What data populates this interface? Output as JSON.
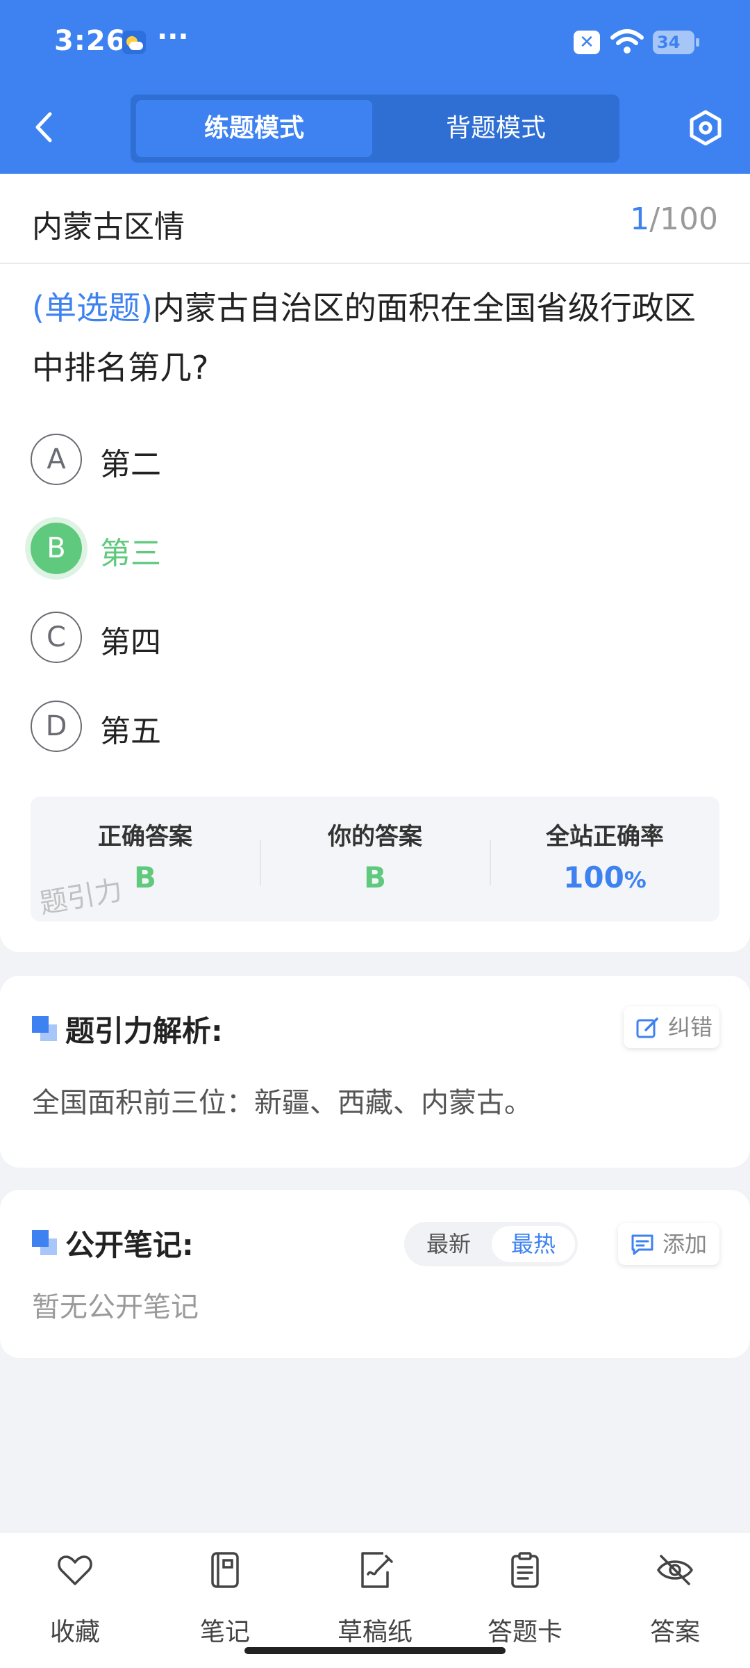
{
  "status_bar": {
    "time": "3:26",
    "more": "···",
    "battery": "34"
  },
  "header": {
    "tabs": [
      {
        "label": "练题模式",
        "active": true
      },
      {
        "label": "背题模式",
        "active": false
      }
    ],
    "icons": {
      "back": "chevron-left-icon",
      "settings": "hexagon-settings-icon"
    },
    "accent_color": "#3d82f0"
  },
  "question_card": {
    "category": "内蒙古区情",
    "progress_current": "1",
    "progress_total": "/100",
    "type_label": "(单选题)",
    "question_text": "内蒙古自治区的面积在全国省级行政区中排名第几?",
    "options": [
      {
        "letter": "A",
        "text": "第二",
        "selected": false
      },
      {
        "letter": "B",
        "text": "第三",
        "selected": true
      },
      {
        "letter": "C",
        "text": "第四",
        "selected": false
      },
      {
        "letter": "D",
        "text": "第五",
        "selected": false
      }
    ],
    "result": {
      "correct_label": "正确答案",
      "correct_value": "B",
      "yours_label": "你的答案",
      "yours_value": "B",
      "rate_label": "全站正确率",
      "rate_value": "100",
      "rate_unit": "%"
    },
    "watermark": "题引力",
    "correct_color": "#5fc97d"
  },
  "analysis": {
    "title": "题引力解析:",
    "report_label": "纠错",
    "content": "全国面积前三位：新疆、西藏、内蒙古。"
  },
  "notes": {
    "title": "公开笔记:",
    "sort_latest": "最新",
    "sort_hot": "最热",
    "add_label": "添加",
    "empty_text": "暂无公开笔记"
  },
  "bottom_nav": [
    {
      "label": "收藏",
      "icon": "heart-icon"
    },
    {
      "label": "笔记",
      "icon": "notebook-icon"
    },
    {
      "label": "草稿纸",
      "icon": "draft-paper-icon"
    },
    {
      "label": "答题卡",
      "icon": "answer-sheet-icon"
    },
    {
      "label": "答案",
      "icon": "eye-off-icon"
    }
  ]
}
